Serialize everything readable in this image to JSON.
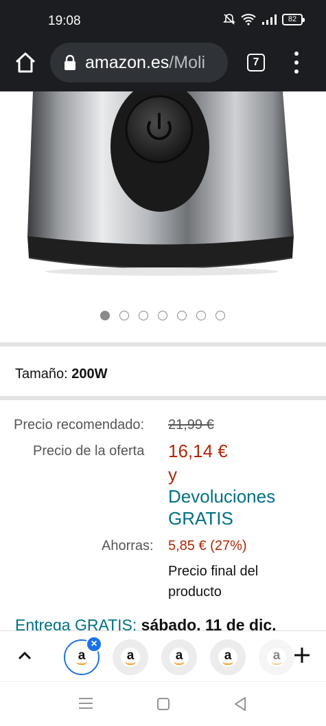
{
  "status_bar": {
    "time": "19:08",
    "battery": "82"
  },
  "browser": {
    "url_domain": "amazon.es",
    "url_path": "/Moli",
    "tab_count": "7"
  },
  "gallery": {
    "image_count": 7,
    "active_index": 0
  },
  "variant": {
    "label": "Tamaño:",
    "value": "200W"
  },
  "pricing": {
    "list_label": "Precio recomendado:",
    "list_price": "21,99 €",
    "offer_label": "Precio de la oferta",
    "offer_price": "16,14 €",
    "and": "y",
    "returns_line1": "Devoluciones",
    "returns_line2": "GRATIS",
    "savings_label": "Ahorras:",
    "savings_value": "5,85 € (27%)",
    "final_line1": "Precio final del",
    "final_line2": "producto"
  },
  "delivery": {
    "label": "Entrega GRATIS:",
    "date": "sábado, 11 de dic."
  },
  "tab_strip": {
    "tab_letter": "a",
    "tabs_visible": 5
  },
  "colors": {
    "accent_blue": "#1a73e8",
    "price_red": "#b12704",
    "link_teal": "#007185",
    "toolbar_dark": "#1b1d20"
  }
}
